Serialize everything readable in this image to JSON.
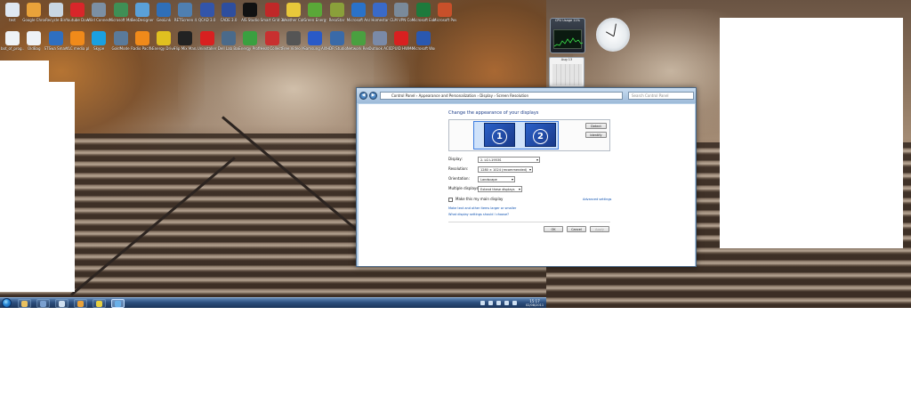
{
  "desktop": {
    "icons_row1": [
      {
        "label": "test",
        "icon": "computer-icon",
        "color": "#dfe8f2"
      },
      {
        "label": "Google Chrome",
        "icon": "chrome-icon",
        "color": "#e9a23a"
      },
      {
        "label": "Recycle Bin",
        "icon": "recycle-bin-icon",
        "color": "#c9d6e2"
      },
      {
        "label": "Youtube Download.",
        "icon": "youtube-downloader-icon",
        "color": "#d8262a"
      },
      {
        "label": "Wild Connect",
        "icon": "wild-connect-icon",
        "color": "#7c8fa3"
      },
      {
        "label": "Microsoft Mathematics",
        "icon": "math-icon",
        "color": "#3f8f55"
      },
      {
        "label": "GeoDesigner 3.1",
        "icon": "geo-icon",
        "color": "#5aa0d8"
      },
      {
        "label": "GeoLink",
        "icon": "globe-icon",
        "color": "#2f6fb8"
      },
      {
        "label": "RETScreen 4",
        "icon": "retscreen-icon",
        "color": "#4f7fb0"
      },
      {
        "label": "QCAD 3.0",
        "icon": "cad-icon",
        "color": "#3355aa"
      },
      {
        "label": "CADE 3.0",
        "icon": "cade-icon",
        "color": "#2e4e9e"
      },
      {
        "label": "AIS Studio",
        "icon": "a-icon",
        "color": "#111111"
      },
      {
        "label": "Smart Grid 3000",
        "icon": "grid-icon",
        "color": "#c02828"
      },
      {
        "label": "Weather Calculator",
        "icon": "weather-icon",
        "color": "#e8c83a"
      },
      {
        "label": "Green Energy",
        "icon": "energy-icon",
        "color": "#5aa838"
      },
      {
        "label": "ResoStar",
        "icon": "star-icon",
        "color": "#8aa03a"
      },
      {
        "label": "Microsoft Analysis",
        "icon": "analysis-icon",
        "color": "#2a72c8"
      },
      {
        "label": "Homestar",
        "icon": "homestar-icon",
        "color": "#3a6ac8"
      },
      {
        "label": "CLM VPN Connector",
        "icon": "vpn-icon",
        "color": "#7a8a9a"
      },
      {
        "label": "Microsoft Excel 2010",
        "icon": "excel-icon",
        "color": "#1e7a3c"
      },
      {
        "label": "Microsoft PowerPoint",
        "icon": "powerpoint-icon",
        "color": "#c8502a"
      }
    ],
    "icons_row2": [
      {
        "label": "bot_of_prog...",
        "icon": "document-icon",
        "color": "#eef2f6"
      },
      {
        "label": "OldBag",
        "icon": "document-icon",
        "color": "#eef2f6"
      },
      {
        "label": "STSwa SmartLit",
        "icon": "lightning-icon",
        "color": "#2f6fc0"
      },
      {
        "label": "VLC media player",
        "icon": "vlc-icon",
        "color": "#f08a1a"
      },
      {
        "label": "Skype",
        "icon": "skype-icon",
        "color": "#1aa0e0"
      },
      {
        "label": "GoldMode",
        "icon": "monitor-icon",
        "color": "#5a7a9a"
      },
      {
        "label": "Radio Pacific",
        "icon": "vlc-icon",
        "color": "#f08a1a"
      },
      {
        "label": "Energy Drive",
        "icon": "energy-drive-icon",
        "color": "#e0c020"
      },
      {
        "label": "Flip Mix Manager",
        "icon": "flip-icon",
        "color": "#222222"
      },
      {
        "label": "Uninstaller",
        "icon": "uninstall-icon",
        "color": "#d82020"
      },
      {
        "label": "Dell Lab Bar",
        "icon": "dell-icon",
        "color": "#4a6a8a"
      },
      {
        "label": "Energy Profits Calculator",
        "icon": "calc-icon",
        "color": "#3aa040"
      },
      {
        "label": "Heat Collect PV Calculator",
        "icon": "heat-icon",
        "color": "#c83030"
      },
      {
        "label": "Free Video MP4 & AVI",
        "icon": "mp4-avi-icon",
        "color": "#555555"
      },
      {
        "label": "Samsung AllShare",
        "icon": "samsung-icon",
        "color": "#2a5ac8"
      },
      {
        "label": "HDR Studio",
        "icon": "hdr-icon",
        "color": "#3a6aa8"
      },
      {
        "label": "Network Recording",
        "icon": "network-icon",
        "color": "#4aa040"
      },
      {
        "label": "Outlook ACO",
        "icon": "outlook-icon",
        "color": "#7a8aa8"
      },
      {
        "label": "CPUID HWMonitor",
        "icon": "cpuid-icon",
        "color": "#d82020"
      },
      {
        "label": "Microsoft Word 2010",
        "icon": "word-icon",
        "color": "#2a58b0"
      }
    ]
  },
  "gadgets": {
    "cpu_title": "CPU Usage 11%",
    "calendar_title": "Aug 13"
  },
  "window": {
    "address": "Control Panel › Appearance and Personalization › Display › Screen Resolution",
    "search_placeholder": "Search Control Panel",
    "heading": "Change the appearance of your displays",
    "monitor1_label": "1",
    "monitor2_label": "2",
    "detect_label": "Detect",
    "identify_label": "Identify",
    "display_label": "Display:",
    "display_value": "2. LG L1953S",
    "resolution_label": "Resolution:",
    "resolution_value": "1280 × 1024 (recommended)",
    "orientation_label": "Orientation:",
    "orientation_value": "Landscape",
    "multiple_label": "Multiple displays:",
    "multiple_value": "Extend these displays",
    "main_display_label": "Make this my main display",
    "advanced_link": "Advanced settings",
    "text_size_link": "Make text and other items larger or smaller",
    "which_settings_link": "What display settings should I choose?",
    "ok_label": "OK",
    "cancel_label": "Cancel",
    "apply_label": "Apply"
  },
  "taskbar": {
    "time": "15:17",
    "date": "02/08/2011",
    "pinned": [
      {
        "icon": "explorer-icon",
        "color": "#e8c060"
      },
      {
        "icon": "powershell-icon",
        "color": "#7aa0d0"
      },
      {
        "icon": "notepad-icon",
        "color": "#d0e0f0"
      },
      {
        "icon": "chrome-icon",
        "color": "#e9a23a"
      },
      {
        "icon": "sticky-notes-icon",
        "color": "#e8d040"
      },
      {
        "icon": "display-settings-icon",
        "color": "#6ab0e8"
      }
    ]
  },
  "colors": {
    "accent": "#1e3f8a",
    "link": "#0a4fb0",
    "monitor_blue": "#2a60c8"
  }
}
